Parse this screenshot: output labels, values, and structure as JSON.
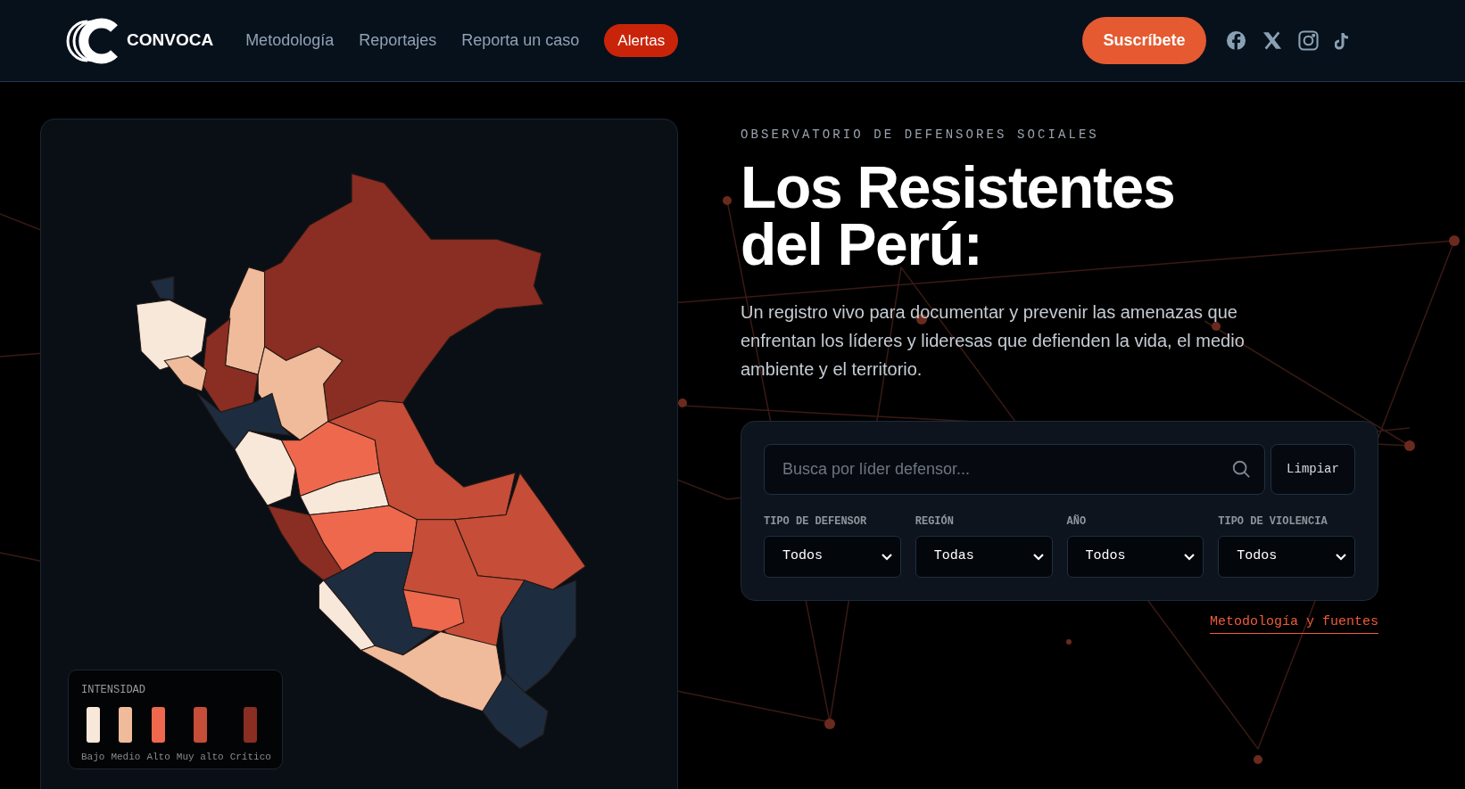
{
  "header": {
    "logo": "CONVOCA",
    "nav": [
      {
        "label": "Metodología",
        "kind": "link"
      },
      {
        "label": "Reportajes",
        "kind": "link"
      },
      {
        "label": "Reporta un caso",
        "kind": "link"
      },
      {
        "label": "Alertas",
        "kind": "alert"
      }
    ],
    "subscribe": "Suscríbete"
  },
  "hero": {
    "eyebrow": "OBSERVATORIO DE DEFENSORES SOCIALES",
    "title_lines": [
      "Los Resistentes",
      "del Perú:"
    ],
    "description": "Un registro vivo para documentar y prevenir las amenazas que enfrentan los líderes y lideresas que defienden la vida, el medio ambiente y el territorio."
  },
  "search": {
    "placeholder": "Busca por líder defensor...",
    "clear_button": "Limpiar",
    "filters": [
      {
        "label": "TIPO DE DEFENSOR",
        "value": "Todos"
      },
      {
        "label": "REGIÓN",
        "value": "Todas"
      },
      {
        "label": "AÑO",
        "value": "Todos"
      },
      {
        "label": "TIPO DE VIOLENCIA",
        "value": "Todos"
      }
    ],
    "link": "Metodología y fuentes"
  },
  "legend": {
    "title": "INTENSIDAD",
    "levels": [
      {
        "label": "Bajo",
        "color": "#f8e8da"
      },
      {
        "label": "Medio",
        "color": "#f0bb9b"
      },
      {
        "label": "Alto",
        "color": "#ee684d"
      },
      {
        "label": "Muy alto",
        "color": "#c64d37"
      },
      {
        "label": "Crítico",
        "color": "#8a2d22"
      }
    ]
  }
}
